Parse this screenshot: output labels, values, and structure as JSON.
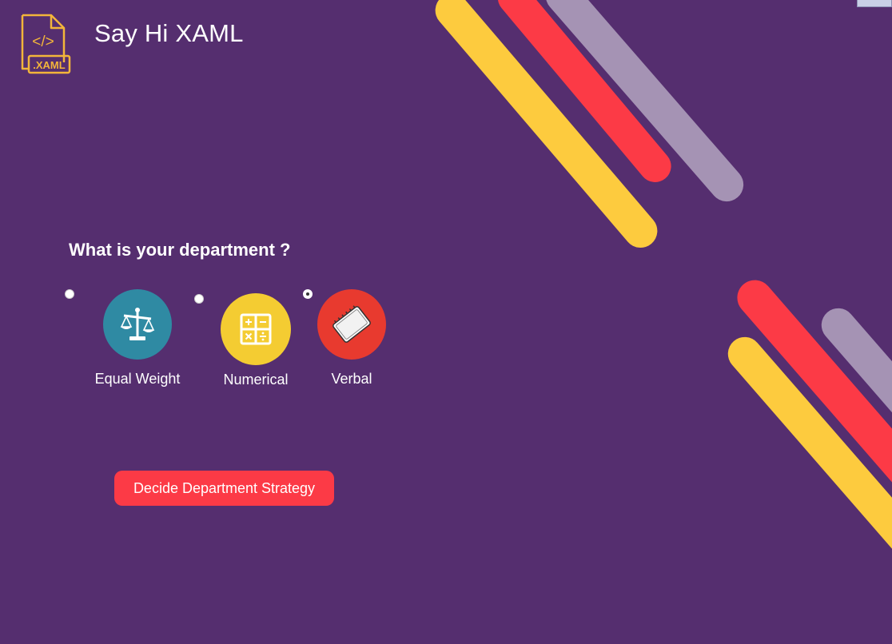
{
  "app": {
    "title": "Say Hi XAML",
    "logo_text": ".XAML",
    "logo_code": "</>"
  },
  "colors": {
    "background": "#552e6f",
    "yellow": "#fdcb3e",
    "red": "#fc3a46",
    "lavender": "#a593b4",
    "teal": "#2f8aa3",
    "button": "#fc3a46"
  },
  "form": {
    "question": "What is your department ?",
    "options": [
      {
        "label": "Equal Weight",
        "icon": "scales-icon",
        "color": "#2f8aa3",
        "selected": false
      },
      {
        "label": "Numerical",
        "icon": "calculator-icon",
        "color": "#f4cc32",
        "selected": false
      },
      {
        "label": "Verbal",
        "icon": "notebook-icon",
        "color": "#e83a2f",
        "selected": true
      }
    ],
    "submit_label": "Decide Department Strategy"
  }
}
